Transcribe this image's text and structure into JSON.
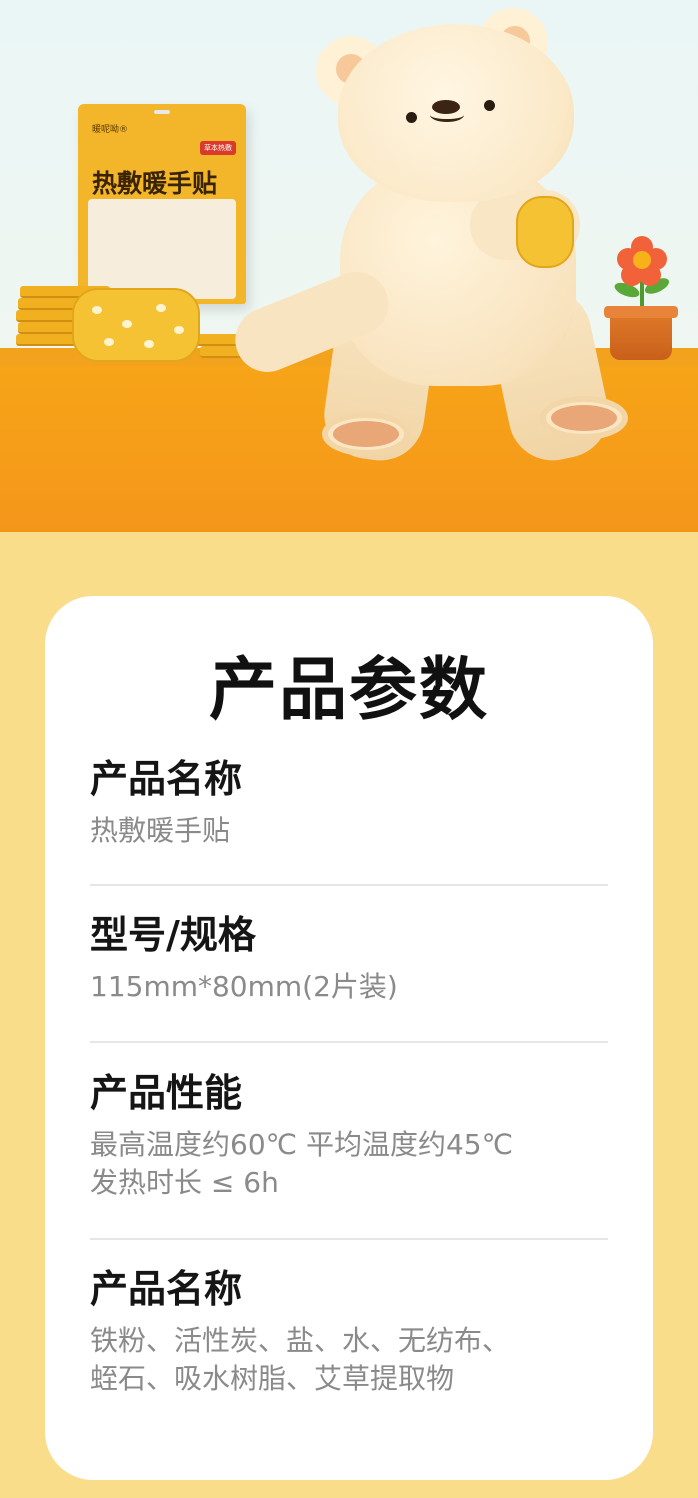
{
  "hero": {
    "package_brand": "暖呢呦®",
    "package_badge": "草本热敷",
    "package_title": "热敷暖手贴"
  },
  "card": {
    "title": "产品参数",
    "sections": [
      {
        "label": "产品名称",
        "value": "热敷暖手贴"
      },
      {
        "label": "型号/规格",
        "value": "115mm*80mm(2片装)"
      },
      {
        "label": "产品性能",
        "value_line1": "最高温度约60℃ 平均温度约45℃",
        "value_line2": "发热时长 ≤ 6h"
      },
      {
        "label": "产品名称",
        "value_line1": "铁粉、活性炭、盐、水、无纺布、",
        "value_line2": "蛭石、吸水树脂、艾草提取物"
      }
    ]
  },
  "colors": {
    "page_background": "#f9dd8a",
    "shelf": "#f4961a",
    "card": "#ffffff",
    "label_text": "#151515",
    "value_text": "#8a8a8a"
  }
}
